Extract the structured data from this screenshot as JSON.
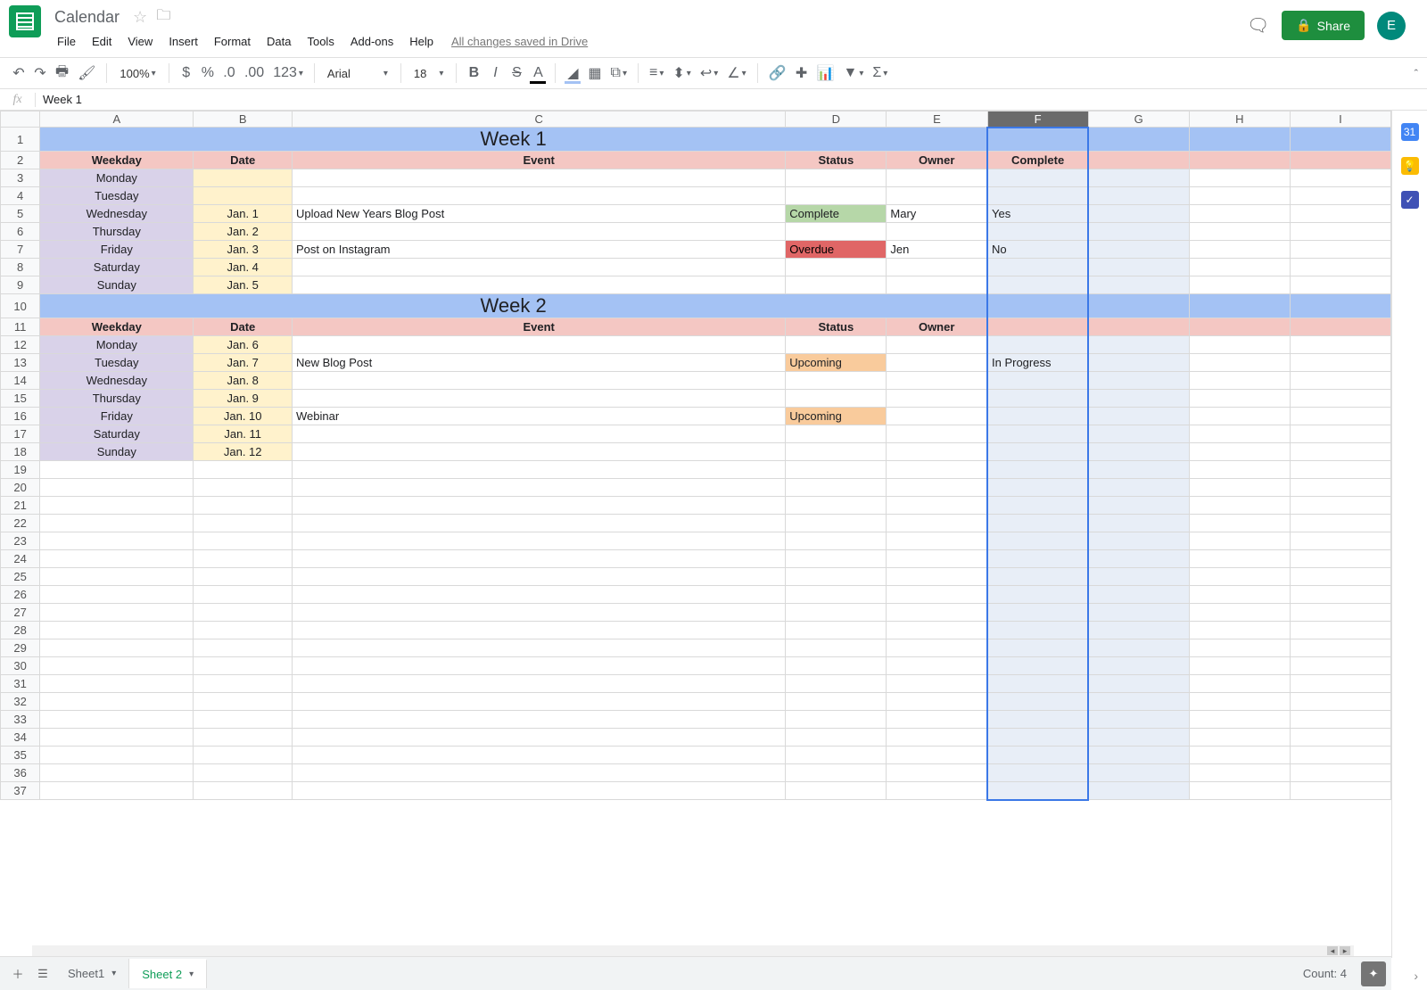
{
  "doc": {
    "title": "Calendar",
    "save_status": "All changes saved in Drive"
  },
  "menus": [
    "File",
    "Edit",
    "View",
    "Insert",
    "Format",
    "Data",
    "Tools",
    "Add-ons",
    "Help"
  ],
  "share": {
    "label": "Share"
  },
  "avatar": {
    "letter": "E"
  },
  "toolbar": {
    "zoom": "100%",
    "number_format": "123",
    "font": "Arial",
    "font_size": "18"
  },
  "formula_bar": {
    "value": "Week 1"
  },
  "columns": [
    "A",
    "B",
    "C",
    "D",
    "E",
    "F",
    "G",
    "H",
    "I"
  ],
  "selected_col_idx": 5,
  "sheet": {
    "weeks": [
      {
        "title": "Week 1",
        "headers": [
          "Weekday",
          "Date",
          "Event",
          "Status",
          "Owner",
          "Complete"
        ],
        "rows": [
          {
            "weekday": "Monday",
            "date": "",
            "event": "",
            "status": "",
            "owner": "",
            "complete": ""
          },
          {
            "weekday": "Tuesday",
            "date": "",
            "event": "",
            "status": "",
            "owner": "",
            "complete": ""
          },
          {
            "weekday": "Wednesday",
            "date": "Jan. 1",
            "event": "Upload New Years Blog Post",
            "status": "Complete",
            "status_kind": "complete",
            "owner": "Mary",
            "complete": "Yes"
          },
          {
            "weekday": "Thursday",
            "date": "Jan. 2",
            "event": "",
            "status": "",
            "owner": "",
            "complete": ""
          },
          {
            "weekday": "Friday",
            "date": "Jan. 3",
            "event": "Post on Instagram",
            "status": "Overdue",
            "status_kind": "overdue",
            "owner": "Jen",
            "complete": "No"
          },
          {
            "weekday": "Saturday",
            "date": "Jan. 4",
            "event": "",
            "status": "",
            "owner": "",
            "complete": ""
          },
          {
            "weekday": "Sunday",
            "date": "Jan. 5",
            "event": "",
            "status": "",
            "owner": "",
            "complete": ""
          }
        ]
      },
      {
        "title": "Week 2",
        "headers": [
          "Weekday",
          "Date",
          "Event",
          "Status",
          "Owner",
          ""
        ],
        "rows": [
          {
            "weekday": "Monday",
            "date": "Jan. 6",
            "event": "",
            "status": "",
            "owner": "",
            "complete": ""
          },
          {
            "weekday": "Tuesday",
            "date": "Jan. 7",
            "event": "New Blog Post",
            "status": "Upcoming",
            "status_kind": "upcoming",
            "owner": "",
            "complete": "In Progress"
          },
          {
            "weekday": "Wednesday",
            "date": "Jan. 8",
            "event": "",
            "status": "",
            "owner": "",
            "complete": ""
          },
          {
            "weekday": "Thursday",
            "date": "Jan. 9",
            "event": "",
            "status": "",
            "owner": "",
            "complete": ""
          },
          {
            "weekday": "Friday",
            "date": "Jan. 10",
            "event": "Webinar",
            "status": "Upcoming",
            "status_kind": "upcoming",
            "owner": "",
            "complete": ""
          },
          {
            "weekday": "Saturday",
            "date": "Jan. 11",
            "event": "",
            "status": "",
            "owner": "",
            "complete": ""
          },
          {
            "weekday": "Sunday",
            "date": "Jan. 12",
            "event": "",
            "status": "",
            "owner": "",
            "complete": ""
          }
        ]
      }
    ],
    "empty_rows": 19
  },
  "footer": {
    "tabs": [
      {
        "name": "Sheet1",
        "active": false
      },
      {
        "name": "Sheet 2",
        "active": true
      }
    ],
    "count_label": "Count: 4"
  }
}
